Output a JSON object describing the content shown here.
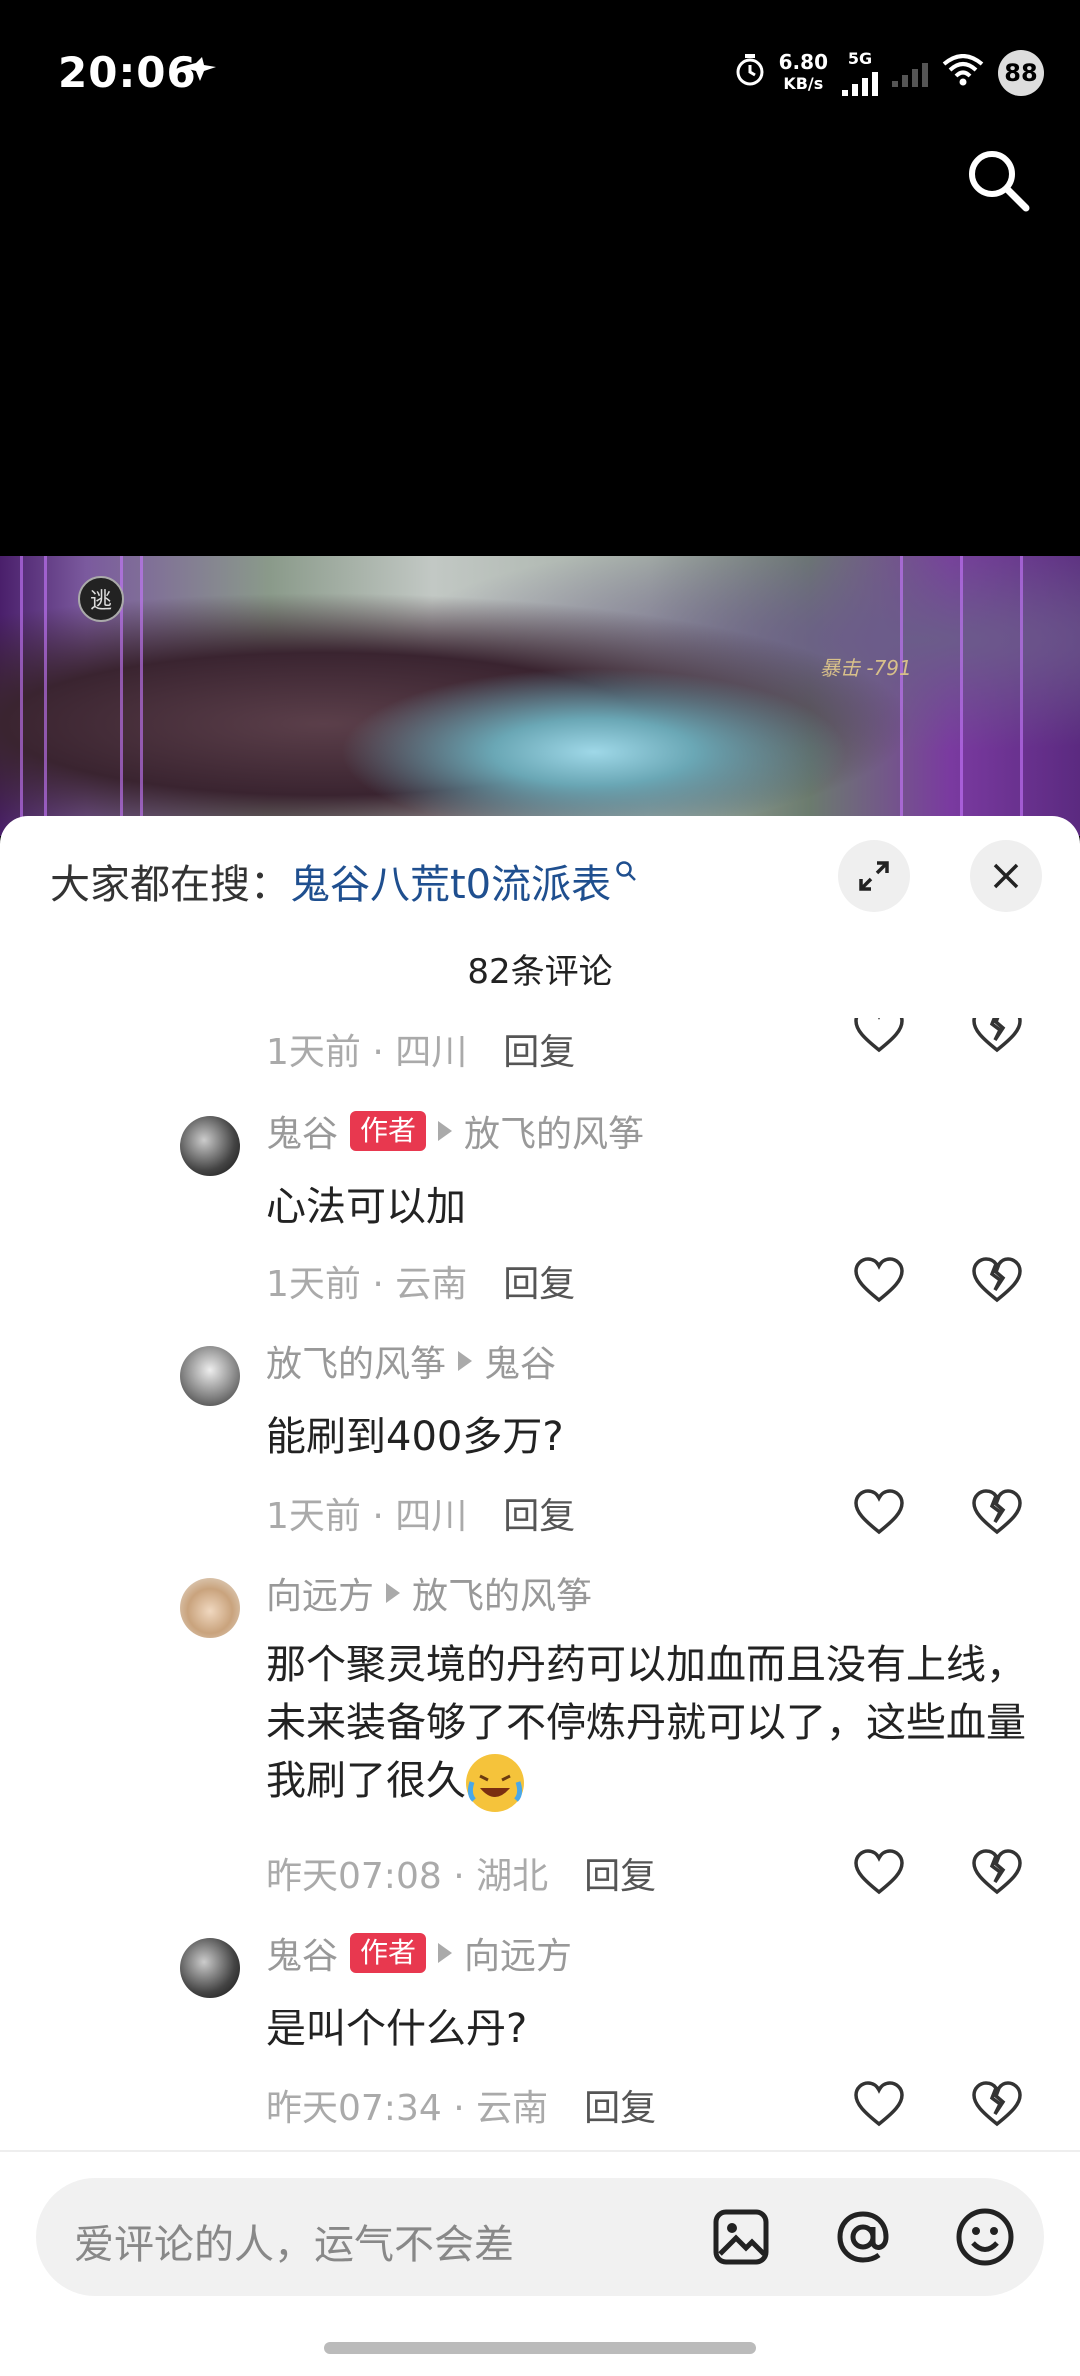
{
  "status_bar": {
    "time": "20:06",
    "net_speed_value": "6.80",
    "net_speed_unit": "KB/s",
    "network_type": "5G",
    "battery": "88"
  },
  "video": {
    "badge": "逃",
    "damage_text": "暴击 -791"
  },
  "search_suggest": {
    "prefix": "大家都在搜：",
    "keyword": "鬼谷八荒t0流派表"
  },
  "comments_header": {
    "count_label": "82条评论"
  },
  "partial_meta": {
    "time": "1天前",
    "location": "四川",
    "reply": "回复"
  },
  "comments": [
    {
      "user": "鬼谷",
      "author_badge": "作者",
      "reply_to": "放飞的风筝",
      "text": "心法可以加",
      "time": "1天前",
      "location": "云南",
      "reply": "回复"
    },
    {
      "user": "放飞的风筝",
      "author_badge": "",
      "reply_to": "鬼谷",
      "text": "能刷到400多万?",
      "time": "1天前",
      "location": "四川",
      "reply": "回复"
    },
    {
      "user": "向远方",
      "author_badge": "",
      "reply_to": "放飞的风筝",
      "text": "那个聚灵境的丹药可以加血而且没有上线，未来装备够了不停炼丹就可以了，这些血量我刷了很久",
      "time": "昨天07:08",
      "location": "湖北",
      "reply": "回复"
    },
    {
      "user": "鬼谷",
      "author_badge": "作者",
      "reply_to": "向远方",
      "text": "是叫个什么丹?",
      "time": "昨天07:34",
      "location": "云南",
      "reply": "回复"
    }
  ],
  "input": {
    "placeholder": "爱评论的人，运气不会差"
  },
  "colors": {
    "author_badge": "#e8384f",
    "keyword": "#1f4f8f"
  }
}
